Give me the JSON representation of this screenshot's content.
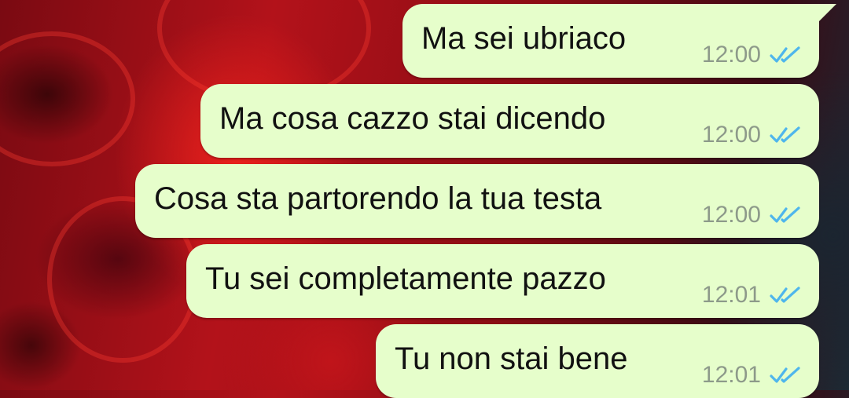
{
  "messages": [
    {
      "text": "Ma sei ubriaco",
      "time": "12:00",
      "status_icon": "double-check-read-icon"
    },
    {
      "text": "Ma cosa cazzo stai dicendo",
      "time": "12:00",
      "status_icon": "double-check-read-icon"
    },
    {
      "text": "Cosa sta partorendo la tua testa",
      "time": "12:00",
      "status_icon": "double-check-read-icon"
    },
    {
      "text": "Tu sei completamente pazzo",
      "time": "12:01",
      "status_icon": "double-check-read-icon"
    },
    {
      "text": "Tu non stai bene",
      "time": "12:01",
      "status_icon": "double-check-read-icon"
    }
  ],
  "colors": {
    "bubble": "#e6fecb",
    "read_ticks": "#4fb6ec",
    "time_text": "#8d9a8a"
  }
}
